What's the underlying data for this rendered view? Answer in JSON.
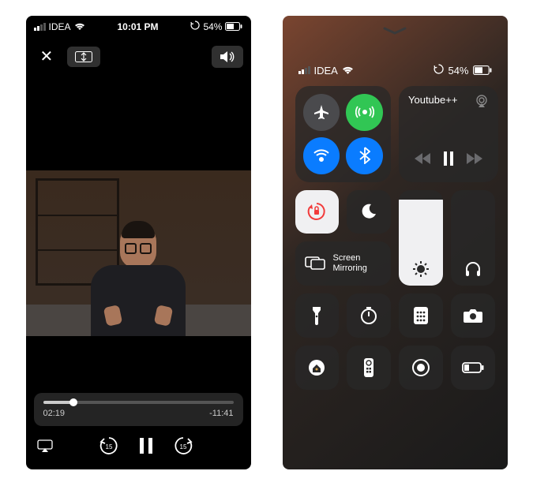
{
  "left": {
    "statusbar": {
      "carrier": "IDEA",
      "time": "10:01 PM",
      "battery_pct": "54%"
    },
    "player": {
      "elapsed": "02:19",
      "remaining": "-11:41",
      "progress_pct": 16,
      "back_seconds": "15",
      "fwd_seconds": "15"
    }
  },
  "right": {
    "statusbar": {
      "carrier": "IDEA",
      "battery_pct": "54%"
    },
    "now_playing": {
      "app": "Youtube++"
    },
    "screen_mirroring_label": "Screen Mirroring",
    "brightness_pct": 90,
    "volume_pct": 0
  }
}
